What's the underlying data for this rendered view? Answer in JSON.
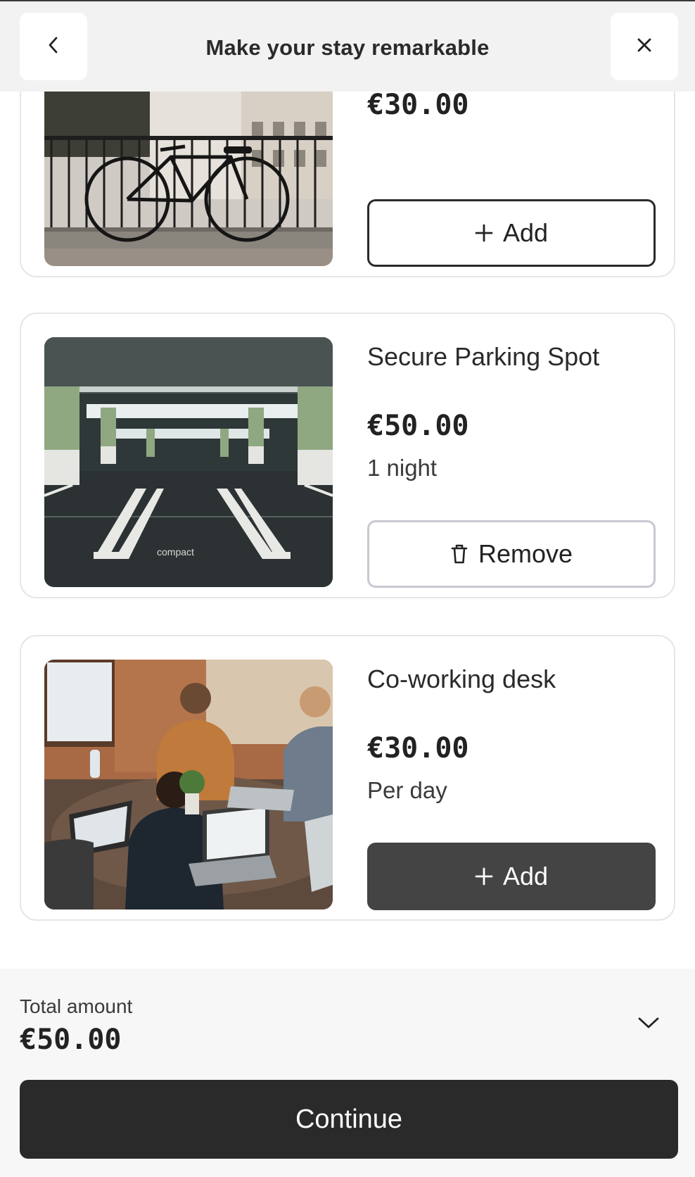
{
  "header": {
    "title": "Make your stay remarkable",
    "back_icon": "chevron-left-icon",
    "close_icon": "close-icon"
  },
  "items": [
    {
      "name": "",
      "price": "€30.00",
      "unit": "",
      "action": "Add",
      "action_icon": "plus-icon",
      "state": "not-added",
      "image": "bicycle-photo"
    },
    {
      "name": "Secure Parking Spot",
      "price": "€50.00",
      "unit": "1 night",
      "action": "Remove",
      "action_icon": "trash-icon",
      "state": "added",
      "image": "parking-garage-photo"
    },
    {
      "name": "Co-working desk",
      "price": "€30.00",
      "unit": "Per day",
      "action": "Add",
      "action_icon": "plus-icon",
      "state": "not-added",
      "image": "coworking-photo"
    }
  ],
  "footer": {
    "total_label": "Total amount",
    "total_value": "€50.00",
    "expand_icon": "chevron-down-icon",
    "continue_label": "Continue"
  },
  "colors": {
    "primary_dark": "#2a2a2a",
    "add_dark": "#444444",
    "remove_border": "#c8c8d2",
    "card_border": "#e6e6e6"
  }
}
